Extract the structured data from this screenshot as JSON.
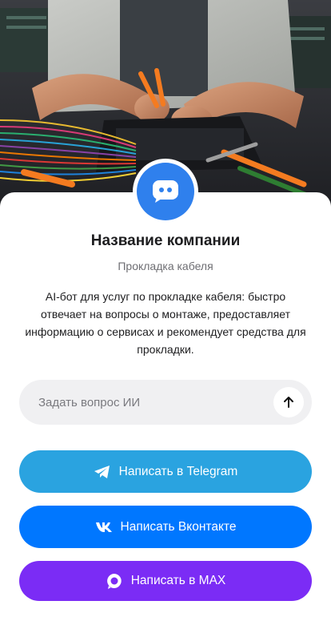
{
  "hero": {
    "image": "cable-installation-photo"
  },
  "profile": {
    "avatar_icon": "chat-bot-icon",
    "company_name": "Название компании",
    "category": "Прокладка кабеля",
    "description": "AI-бот для услуг по прокладке кабеля: быстро отвечает на вопросы о монтаже, предоставляет информацию о сервисах и рекомендует средства для прокладки."
  },
  "ask": {
    "placeholder": "Задать вопрос ИИ",
    "value": "",
    "send_icon": "arrow-up-icon"
  },
  "actions": {
    "telegram": {
      "label": "Написать в Telegram",
      "icon": "telegram-icon",
      "color": "#2aa3e0"
    },
    "vk": {
      "label": "Написать Вконтакте",
      "icon": "vk-icon",
      "color": "#0077ff"
    },
    "max": {
      "label": "Написать в MAX",
      "icon": "max-icon",
      "color": "#7b2cf5"
    }
  },
  "colors": {
    "accent": "#2f80ed",
    "text_primary": "#1d1d1f",
    "text_secondary": "#6e6e73",
    "input_bg": "#f0f0f2"
  }
}
